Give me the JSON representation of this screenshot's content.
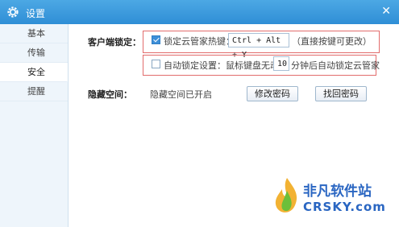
{
  "window": {
    "title": "设置"
  },
  "sidebar": {
    "items": [
      {
        "label": "基本"
      },
      {
        "label": "传输"
      },
      {
        "label": "安全"
      },
      {
        "label": "提醒"
      }
    ]
  },
  "client_lock": {
    "label": "客户端锁定：",
    "hotkey_checkbox_label": "锁定云管家热键：",
    "hotkey_checked": true,
    "hotkey_value": "Ctrl + Alt + Y",
    "hotkey_hint": "（直接按键可更改）",
    "auto_lock_checkbox_label": "自动锁定设置：鼠标键盘无动作",
    "auto_lock_checked": false,
    "auto_lock_minutes": "10",
    "auto_lock_suffix": "分钟后自动锁定云管家"
  },
  "hidden_space": {
    "label": "隐藏空间：",
    "status": "隐藏空间已开启",
    "change_password_label": "修改密码",
    "recover_password_label": "找回密码"
  },
  "watermark": {
    "cn": "非凡软件站",
    "en": "CRSKY.com"
  },
  "colors": {
    "titlebar": "#3a9ade",
    "highlight_border": "#e26c6c",
    "sidebar_bg": "#eef5fb",
    "checkbox_checked": "#3d8fd8"
  }
}
